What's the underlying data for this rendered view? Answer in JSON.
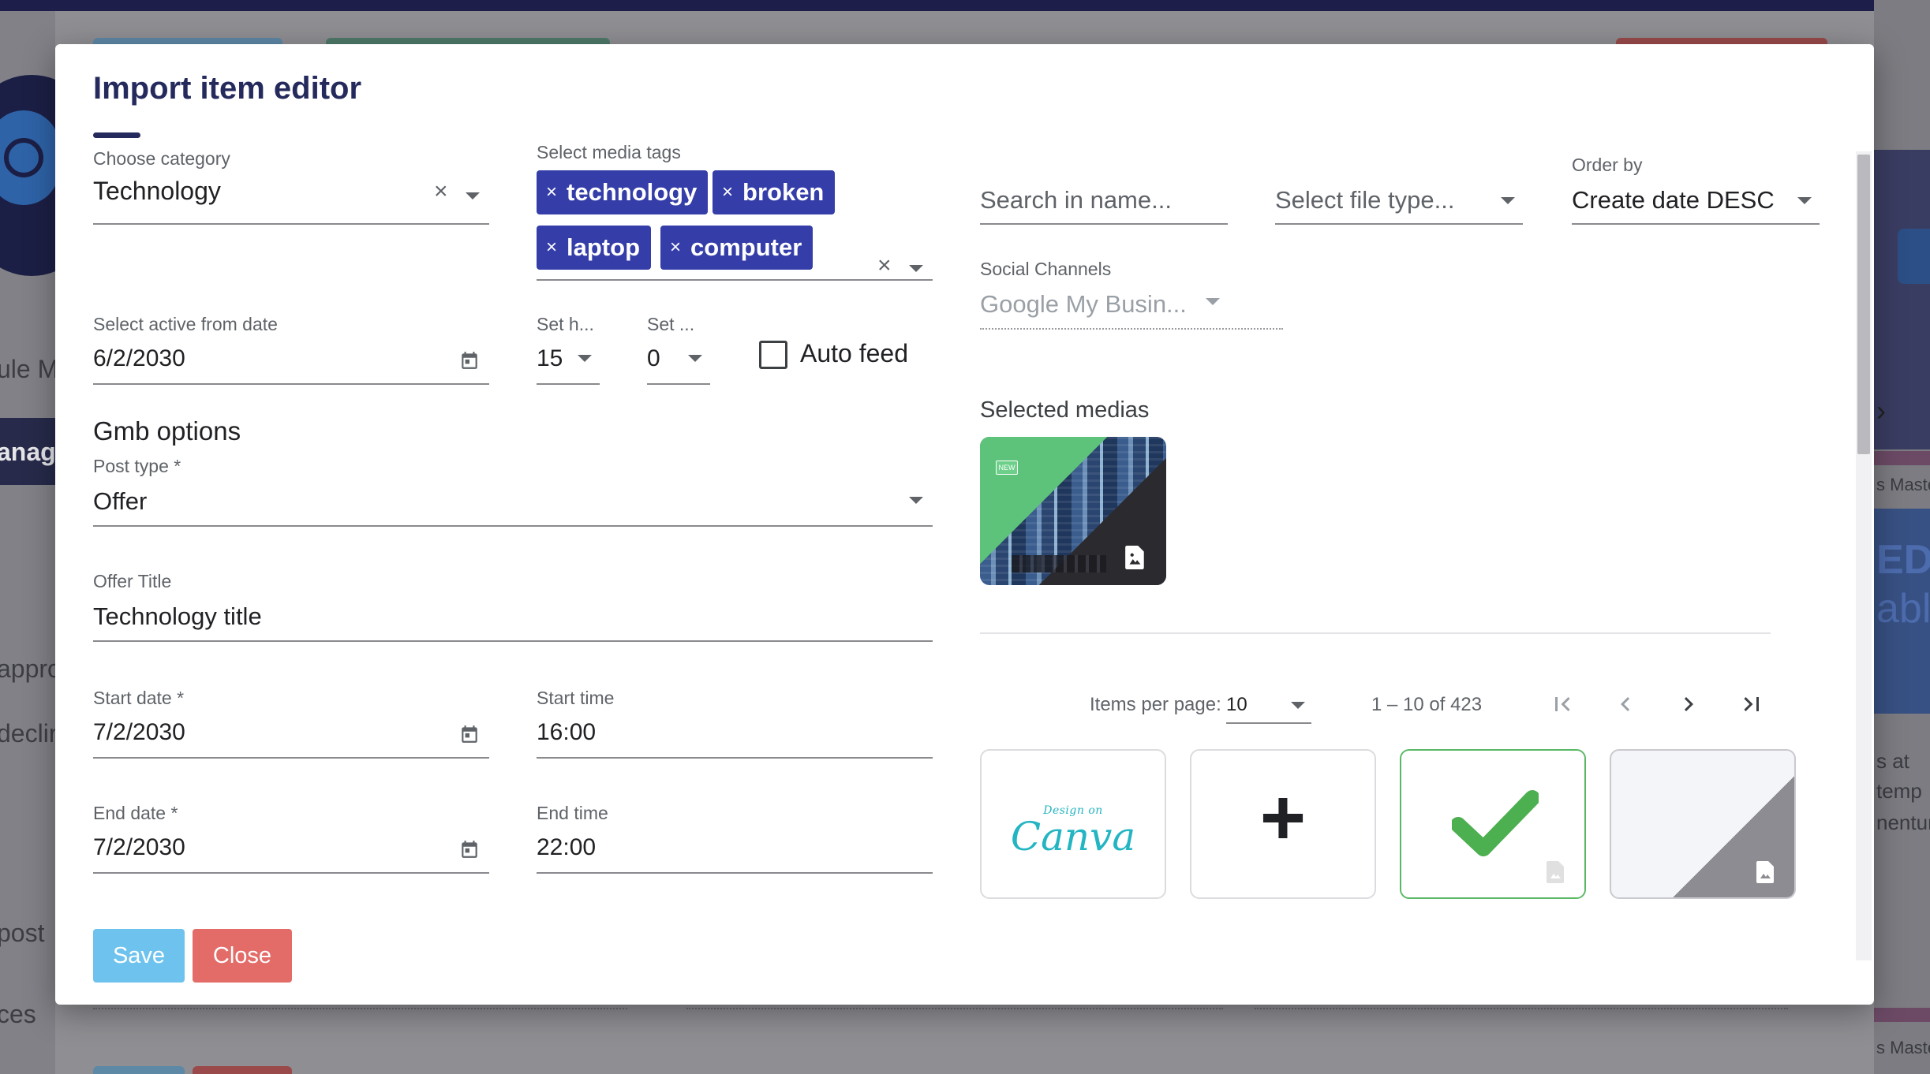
{
  "background": {
    "left_fragments": [
      "ule Me",
      "anag",
      "appro",
      "declin",
      "post",
      "ces"
    ],
    "right_fragments": [
      "s Maste",
      "EDIA",
      "able",
      "s at",
      "temp",
      "nentur",
      "s Maste"
    ]
  },
  "dialog": {
    "title": "Import item editor",
    "category": {
      "label": "Choose category",
      "value": "Technology"
    },
    "media_tags": {
      "label": "Select media tags",
      "tags": [
        "technology",
        "broken",
        "laptop",
        "computer"
      ]
    },
    "search": {
      "placeholder": "Search in name..."
    },
    "file_type": {
      "placeholder": "Select file type..."
    },
    "order_by": {
      "label": "Order by",
      "value": "Create date DESC"
    },
    "social_channels": {
      "label": "Social Channels",
      "value": "Google My Busin..."
    },
    "active_from": {
      "label": "Select active from date",
      "value": "6/2/2030"
    },
    "set_hour": {
      "label": "Set h...",
      "value": "15"
    },
    "set_minute": {
      "label": "Set ...",
      "value": "0"
    },
    "auto_feed": {
      "label": "Auto feed",
      "checked": false
    },
    "gmb": {
      "section_title": "Gmb options",
      "post_type": {
        "label": "Post type *",
        "value": "Offer"
      },
      "offer_title": {
        "label": "Offer Title",
        "value": "Technology title"
      },
      "start_date": {
        "label": "Start date *",
        "value": "7/2/2030"
      },
      "start_time": {
        "label": "Start time",
        "value": "16:00"
      },
      "end_date": {
        "label": "End date *",
        "value": "7/2/2030"
      },
      "end_time": {
        "label": "End time",
        "value": "22:00"
      }
    },
    "selected_medias": {
      "label": "Selected medias",
      "badge": "NEW"
    },
    "pagination": {
      "items_per_page_label": "Items per page:",
      "items_per_page": "10",
      "range": "1 – 10 of 423"
    },
    "media_grid": {
      "canva_top": "Design on",
      "canva_brand": "Canva",
      "add_symbol": "+"
    },
    "buttons": {
      "save": "Save",
      "close": "Close"
    }
  },
  "colors": {
    "primary": "#252a5d",
    "chip": "#353ea8",
    "save": "#6ec3ee",
    "close": "#e36b68",
    "check": "#4caf50",
    "canva": "#23b5c2"
  },
  "icons": [
    "calendar-icon",
    "clear-icon",
    "chevron-down-icon",
    "image-file-icon",
    "check-icon",
    "first-page-icon",
    "prev-page-icon",
    "next-page-icon",
    "last-page-icon",
    "plus-icon"
  ]
}
